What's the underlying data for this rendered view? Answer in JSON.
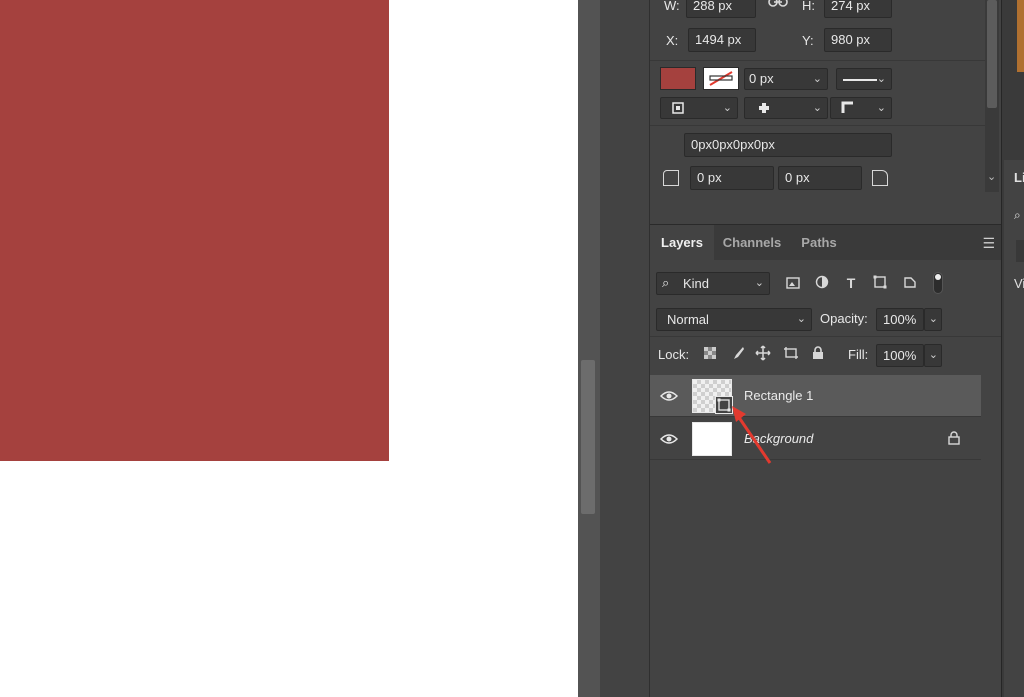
{
  "properties": {
    "w_label": "W:",
    "w_value": "288 px",
    "h_label": "H:",
    "h_value": "274 px",
    "x_label": "X:",
    "x_value": "1494 px",
    "y_label": "Y:",
    "y_value": "980 px",
    "stroke_width": "0 px",
    "corner_radius_text": "0px0px0px0px",
    "corner_tl": "0 px",
    "corner_tr": "0 px",
    "fill_color": "#a5413e"
  },
  "layers_panel": {
    "tabs": [
      "Layers",
      "Channels",
      "Paths"
    ],
    "filter_kind": "Kind",
    "blend_mode": "Normal",
    "opacity_label": "Opacity:",
    "opacity_value": "100%",
    "lock_label": "Lock:",
    "fill_label": "Fill:",
    "fill_value": "100%",
    "layers": [
      {
        "name": "Rectangle 1",
        "selected": true
      },
      {
        "name": "Background",
        "selected": false
      }
    ]
  },
  "right_edge": {
    "title_fragment": "Li",
    "label_fragment": "Vi"
  },
  "colors": {
    "canvas_rect": "#a5413e",
    "panel_bg": "#434343",
    "arrow": "#e23a2f"
  }
}
